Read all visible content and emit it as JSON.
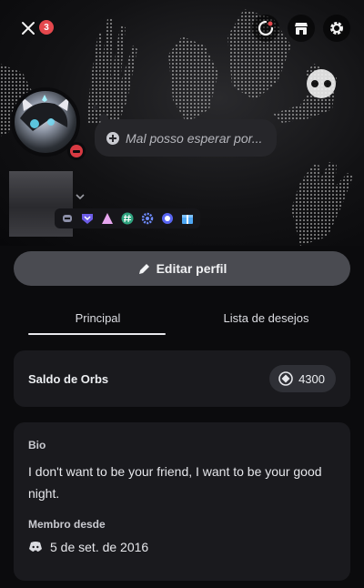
{
  "topbar": {
    "notification_count": "3"
  },
  "status": {
    "text": "Mal posso esperar por..."
  },
  "profile": {
    "edit_label": "Editar perfil"
  },
  "tabs": [
    {
      "label": "Principal",
      "active": true
    },
    {
      "label": "Lista de desejos",
      "active": false
    }
  ],
  "orbs": {
    "title": "Saldo de Orbs",
    "value": "4300"
  },
  "bio": {
    "title": "Bio",
    "text": "I don't want to be your friend, I want to be your good night.",
    "member_title": "Membro desde",
    "member_since": "5 de set. de 2016"
  },
  "badges": [
    "hypesquad-icon",
    "shield-badge-icon",
    "nitro-triangle-icon",
    "hashtag-badge-icon",
    "gear-badge-icon",
    "orb-badge-icon",
    "gift-badge-icon"
  ],
  "colors": {
    "background": "#0b0b0d",
    "card": "#1a1a1e",
    "button": "#4a4b51",
    "dnd": "#d83a42",
    "badge_red": "#e5484d"
  }
}
